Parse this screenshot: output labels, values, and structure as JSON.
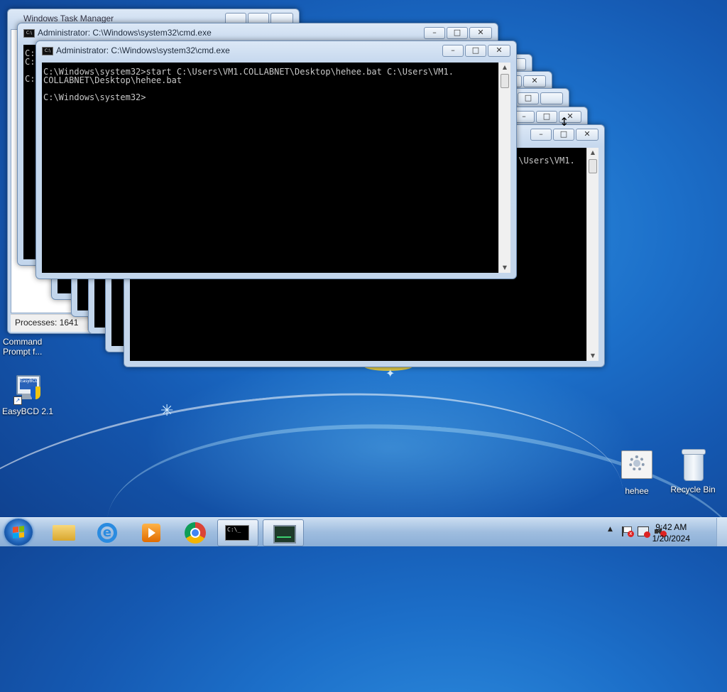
{
  "windows": {
    "back_title": "Windows Task Manager",
    "cmd_title": "Administrator: C:\\Windows\\system32\\cmd.exe",
    "main_console_line1": "C:\\Windows\\system32>start C:\\Users\\VM1.COLLABNET\\Desktop\\hehee.bat C:\\Users\\VM1.",
    "main_console_line2": "COLLABNET\\Desktop\\hehee.bat",
    "main_console_line3": "C:\\Windows\\system32>",
    "right_console_line": ":\\Users\\VM1.",
    "left_console_line_a": "C:",
    "left_console_line_b": "C:",
    "left_console_line_c": "C:",
    "processes_label": "Processes: 1641",
    "minimize_glyph": "–",
    "maximize_glyph": "□",
    "close_glyph": "✕"
  },
  "desktop": {
    "cmd_shortcut_label_1": "Command",
    "cmd_shortcut_label_2": "Prompt f...",
    "easybcd_label": "EasyBCD 2.1",
    "easybcd_inner": "EasyBCD",
    "hehee_label": "hehee",
    "recycle_label": "Recycle Bin"
  },
  "taskbar": {
    "time": "9:42 AM",
    "date": "1/20/2024",
    "cmd_glyph": "C:\\_",
    "tray_arrow": "▲",
    "icons": [
      "start-orb-icon",
      "file-explorer-icon",
      "internet-explorer-icon",
      "media-player-icon",
      "chrome-icon",
      "cmd-icon",
      "task-manager-icon"
    ]
  }
}
